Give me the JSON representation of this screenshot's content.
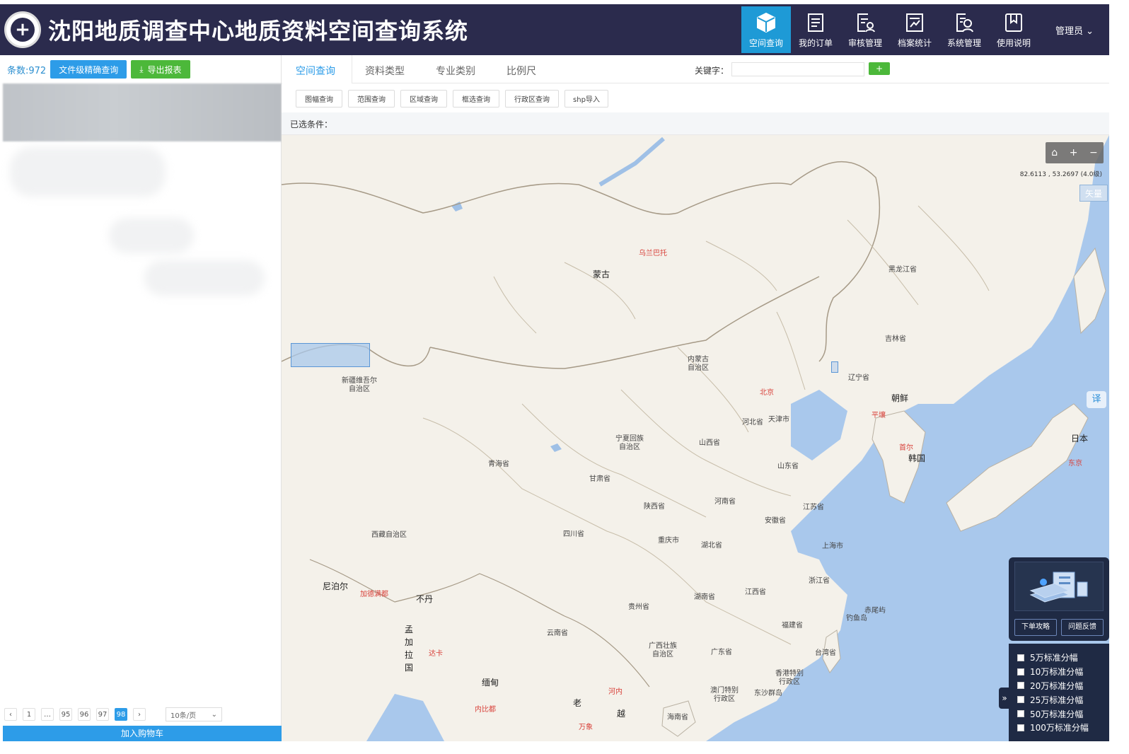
{
  "header": {
    "title": "沈阳地质调查中心地质资料空间查询系统",
    "nav": [
      {
        "label": "空间查询",
        "icon": "cube-icon",
        "active": true
      },
      {
        "label": "我的订单",
        "icon": "order-list-icon"
      },
      {
        "label": "审核管理",
        "icon": "audit-icon"
      },
      {
        "label": "档案统计",
        "icon": "statistics-icon"
      },
      {
        "label": "系统管理",
        "icon": "system-user-icon"
      },
      {
        "label": "使用说明",
        "icon": "bookmark-icon"
      }
    ],
    "user": "管理员"
  },
  "left": {
    "count_label": "条数:972",
    "precise_query": "文件级精确查询",
    "export": "导出报表",
    "pager": {
      "pages": [
        "1",
        "…",
        "95",
        "96",
        "97",
        "98"
      ],
      "current": "98",
      "prev": "‹",
      "next": "›",
      "per_page": "10条/页"
    },
    "add_cart": "加入购物车"
  },
  "tabs": {
    "items": [
      "空间查询",
      "资料类型",
      "专业类别",
      "比例尺"
    ],
    "keyword_label": "关键字：",
    "keyword_value": "",
    "add": "+"
  },
  "subtools": [
    "图幅查询",
    "范围查询",
    "区域查询",
    "框选查询",
    "行政区查询",
    "shp导入"
  ],
  "conditions_label": "已选条件：",
  "map": {
    "coords": "82.6113 , 53.2697 (4.0级)",
    "vector": "矢量",
    "translate": "译",
    "labels": {
      "mongolia": "蒙古",
      "ulaanbaatar": "乌兰巴托",
      "heilongjiang": "黑龙江省",
      "jilin": "吉林省",
      "liaoning": "辽宁省",
      "innermongolia": "内蒙古\n自治区",
      "xinjiang": "新疆维吾尔\n自治区",
      "beijing": "北京",
      "hebei": "河北省",
      "tianjin": "天津市",
      "northkorea": "朝鲜",
      "pyongyang": "平壤",
      "seoul": "首尔",
      "korea": "韩国",
      "japan": "日本",
      "tokyo": "东京",
      "ningxia": "宁夏回族\n自治区",
      "shanxi": "山西省",
      "qinghai": "青海省",
      "gansu": "甘肃省",
      "shandong": "山东省",
      "henan": "河南省",
      "shaanxi": "陕西省",
      "jiangsu": "江苏省",
      "anhui": "安徽省",
      "tibet": "西藏自治区",
      "sichuan": "四川省",
      "chongqing": "重庆市",
      "hubei": "湖北省",
      "shanghai": "上海市",
      "zhejiang": "浙江省",
      "nepal": "尼泊尔",
      "kathmandu": "加德满都",
      "bhutan": "不丹",
      "bangladesh": "孟\n加\n拉\n国",
      "dhaka": "达卡",
      "hunan": "湖南省",
      "jiangxi": "江西省",
      "guizhou": "贵州省",
      "yunnan": "云南省",
      "fujian": "福建省",
      "chiwei": "赤尾屿",
      "diaoyu": "钓鱼岛",
      "taiwan": "台湾省",
      "guangxi": "广西壮族\n自治区",
      "guangdong": "广东省",
      "hongkong": "香港特别\n行政区",
      "macau": "澳门特别\n行政区",
      "dongsha": "东沙群岛",
      "myanmar": "缅甸",
      "hanoi": "河内",
      "naypyidaw": "内比都",
      "laos": "老",
      "vietnam": "越",
      "vientiane": "万象",
      "hainan": "海南省"
    }
  },
  "guide": {
    "order_guide": "下单攻略",
    "feedback": "问题反馈"
  },
  "scales": [
    "5万标准分幅",
    "10万标准分幅",
    "20万标准分幅",
    "25万标准分幅",
    "50万标准分幅",
    "100万标准分幅"
  ],
  "colors": {
    "header_bg": "#2b2b4d",
    "accent": "#1e9ad6",
    "green": "#4cb83a",
    "sea": "#a9c8ec",
    "land": "#f4f1ea"
  }
}
